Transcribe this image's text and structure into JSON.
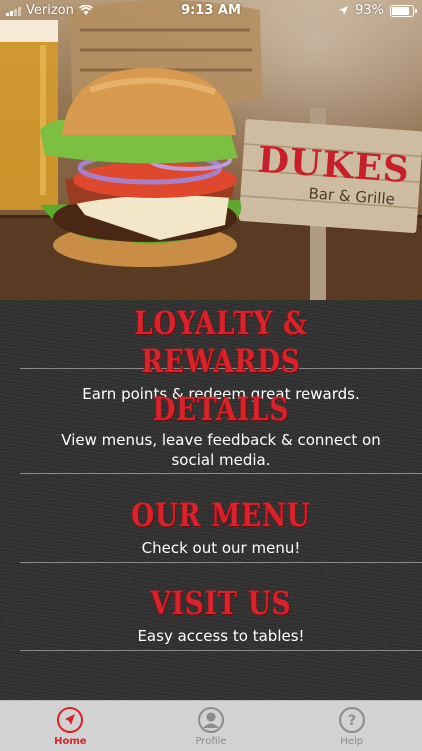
{
  "status_bar": {
    "carrier": "Verizon",
    "time": "9:13 AM",
    "battery": "93%"
  },
  "hero": {
    "sign_title": "DUKES",
    "sign_subtitle": "Bar & Grille"
  },
  "sections": [
    {
      "title": "LOYALTY & REWARDS",
      "description": "Earn points & redeem great rewards."
    },
    {
      "title": "DETAILS",
      "description": "View menus, leave feedback & connect on social media."
    },
    {
      "title": "OUR MENU",
      "description": "Check out our menu!"
    },
    {
      "title": "VISIT US",
      "description": "Easy access to tables!"
    }
  ],
  "tab_bar": {
    "tabs": [
      {
        "label": "Home",
        "icon": "location-arrow-icon",
        "active": true
      },
      {
        "label": "Profile",
        "icon": "profile-icon",
        "active": false
      },
      {
        "label": "Help",
        "icon": "help-icon",
        "active": false
      }
    ]
  },
  "colors": {
    "accent_red": "#d9232a",
    "background": "#323232",
    "tab_bar": "#d2d2d2"
  }
}
